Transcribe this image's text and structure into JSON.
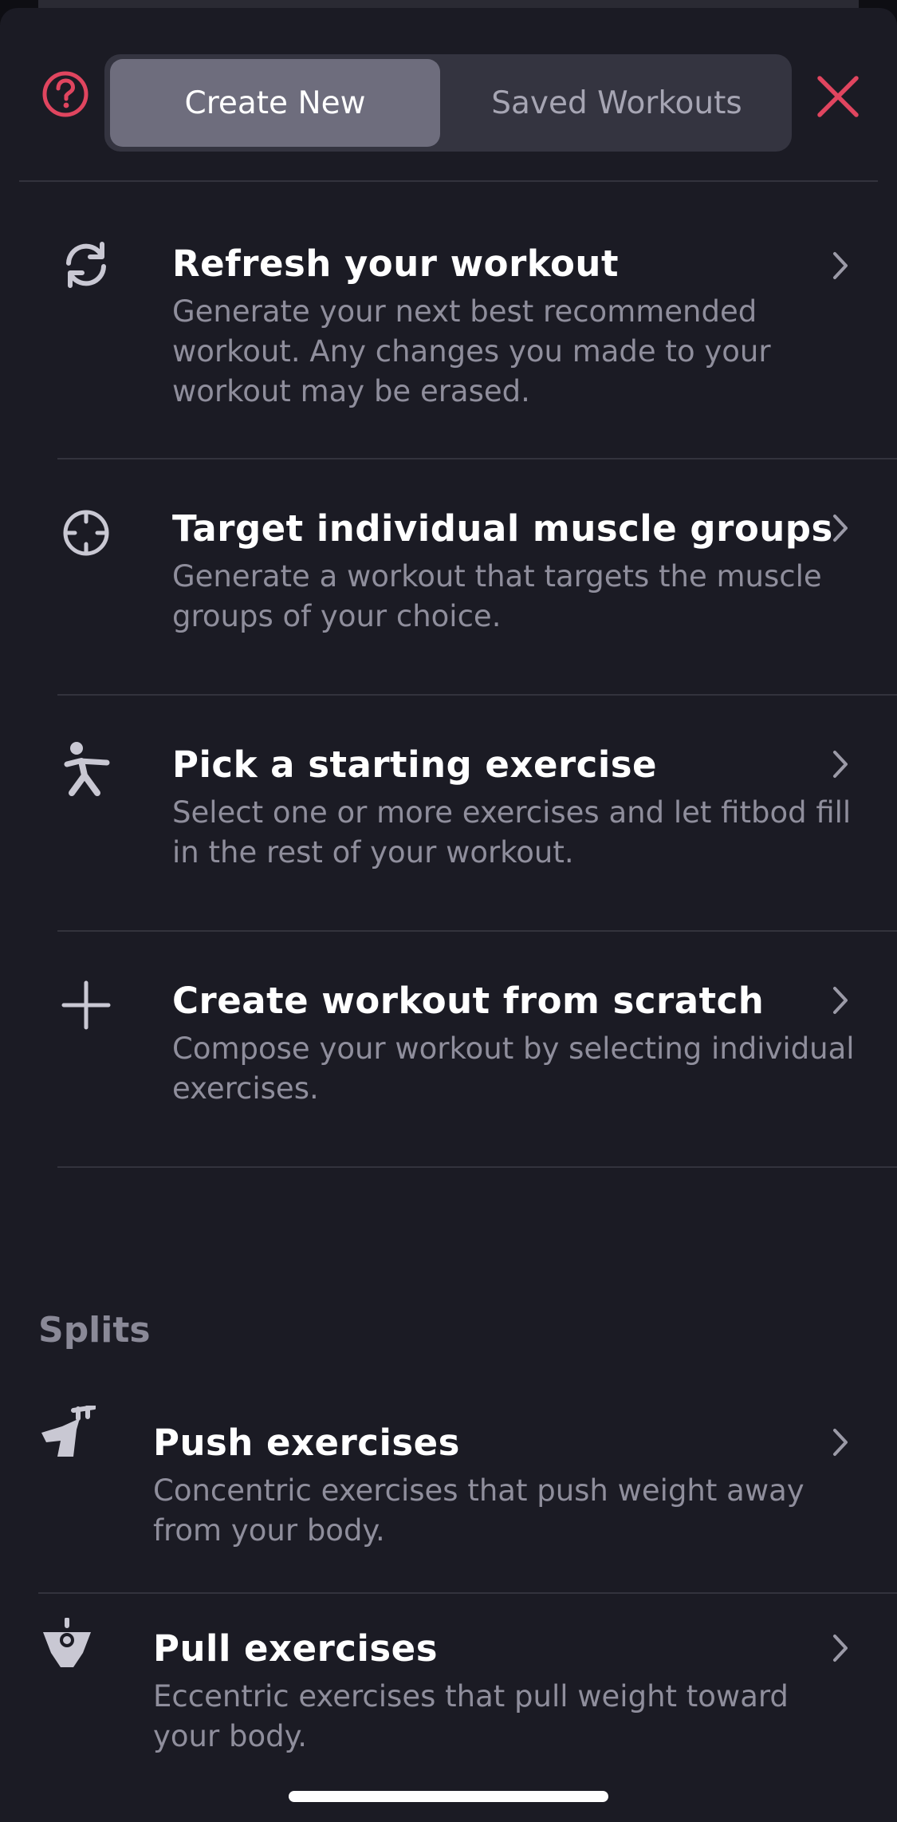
{
  "header": {
    "tabs": [
      {
        "label": "Create New",
        "active": true
      },
      {
        "label": "Saved Workouts",
        "active": false
      }
    ],
    "help_icon": "question-circle-icon",
    "close_icon": "close-icon"
  },
  "options": [
    {
      "icon": "refresh-icon",
      "title": "Refresh your workout",
      "description": "Generate your next best recommended workout. Any changes you made to your workout may be erased."
    },
    {
      "icon": "crosshair-icon",
      "title": "Target individual muscle groups",
      "description": "Generate a workout that targets the muscle groups of your choice."
    },
    {
      "icon": "exercise-figure-icon",
      "title": "Pick a starting exercise",
      "description": "Select one or more exercises and let fitbod fill in the rest of your workout."
    },
    {
      "icon": "plus-icon",
      "title": "Create workout from scratch",
      "description": "Compose your workout by selecting individual exercises."
    }
  ],
  "splits": {
    "title": "Splits",
    "items": [
      {
        "icon": "push-icon",
        "title": "Push exercises",
        "description": "Concentric exercises that push weight away from your body."
      },
      {
        "icon": "pull-icon",
        "title": "Pull exercises",
        "description": "Eccentric exercises that pull weight toward your body."
      }
    ]
  },
  "colors": {
    "accent": "#e0455f",
    "background": "#1b1b24",
    "segment_active": "#6e6d7d"
  }
}
